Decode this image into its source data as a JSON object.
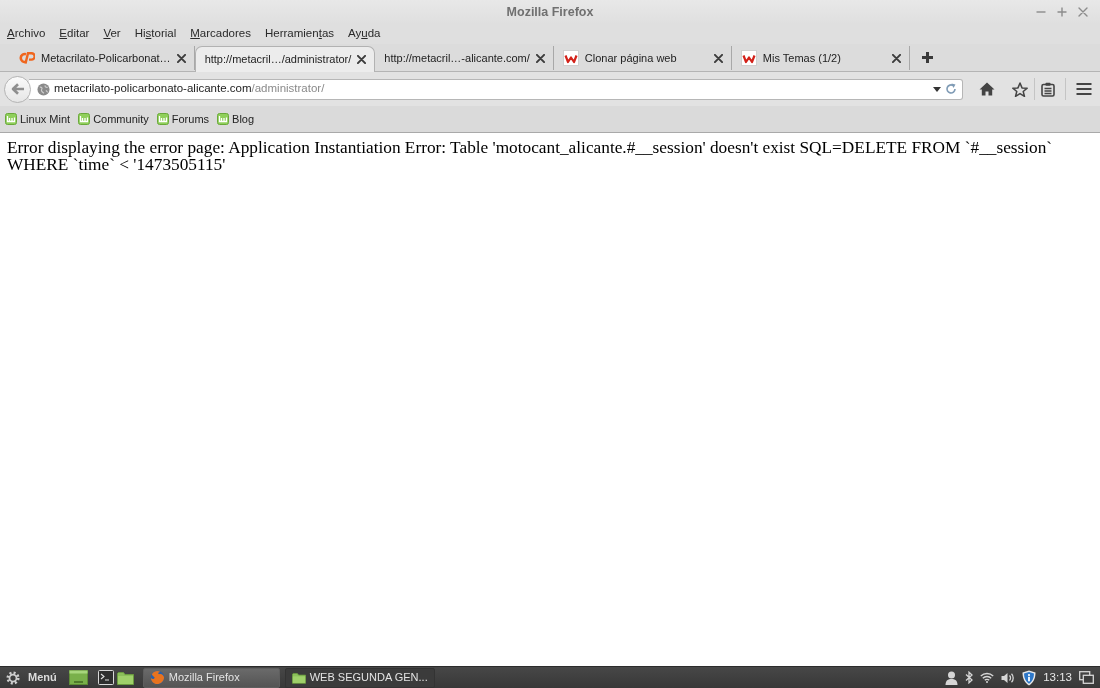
{
  "window": {
    "title": "Mozilla Firefox"
  },
  "menu_bar": [
    {
      "label": [
        {
          "text": "A",
          "mnemonic": true
        },
        {
          "text": "rchivo",
          "mnemonic": false
        }
      ]
    },
    {
      "label": [
        {
          "text": "E",
          "mnemonic": true
        },
        {
          "text": "ditar",
          "mnemonic": false
        }
      ]
    },
    {
      "label": [
        {
          "text": "V",
          "mnemonic": true
        },
        {
          "text": "er",
          "mnemonic": false
        }
      ]
    },
    {
      "label": [
        {
          "text": "Hi",
          "mnemonic": false
        },
        {
          "text": "s",
          "mnemonic": true
        },
        {
          "text": "torial",
          "mnemonic": false
        }
      ]
    },
    {
      "label": [
        {
          "text": "M",
          "mnemonic": true
        },
        {
          "text": "arcadores",
          "mnemonic": false
        }
      ]
    },
    {
      "label": [
        {
          "text": "Herramien",
          "mnemonic": false
        },
        {
          "text": "t",
          "mnemonic": true
        },
        {
          "text": "as",
          "mnemonic": false
        }
      ]
    },
    {
      "label": [
        {
          "text": "Ay",
          "mnemonic": false
        },
        {
          "text": "u",
          "mnemonic": true
        },
        {
          "text": "da",
          "mnemonic": false
        }
      ]
    }
  ],
  "tabs": [
    {
      "title": "Metacrilato-Policarbonat…",
      "selected": false,
      "kind": "cplogo"
    },
    {
      "title": "http://metacril…/administrator/",
      "selected": true,
      "kind": "plain"
    },
    {
      "title": "http://metacril…-alicante.com/",
      "selected": false,
      "kind": "plain"
    },
    {
      "title": "Clonar página web",
      "selected": false,
      "kind": "wlogo"
    },
    {
      "title": "Mis Temas (1/2)",
      "selected": false,
      "kind": "wlogo"
    }
  ],
  "address_bar": {
    "host": "metacrilato-policarbonato-alicante.com",
    "path": "/administrator/"
  },
  "bookmarks": [
    {
      "label": "Linux Mint"
    },
    {
      "label": "Community"
    },
    {
      "label": "Forums"
    },
    {
      "label": "Blog"
    }
  ],
  "page": {
    "error_text": "Error displaying the error page: Application Instantiation Error: Table 'motocant_alicante.#__session' doesn't exist SQL=DELETE FROM `#__session` WHERE `time` < '1473505115'"
  },
  "taskbar": {
    "menu_label": "Menú",
    "windows": [
      {
        "label": "Mozilla Firefox",
        "selected": true,
        "kind": "browser"
      },
      {
        "label": "WEB SEGUNDA GEN...",
        "selected": false,
        "kind": "folder"
      }
    ],
    "clock": "13:13"
  }
}
